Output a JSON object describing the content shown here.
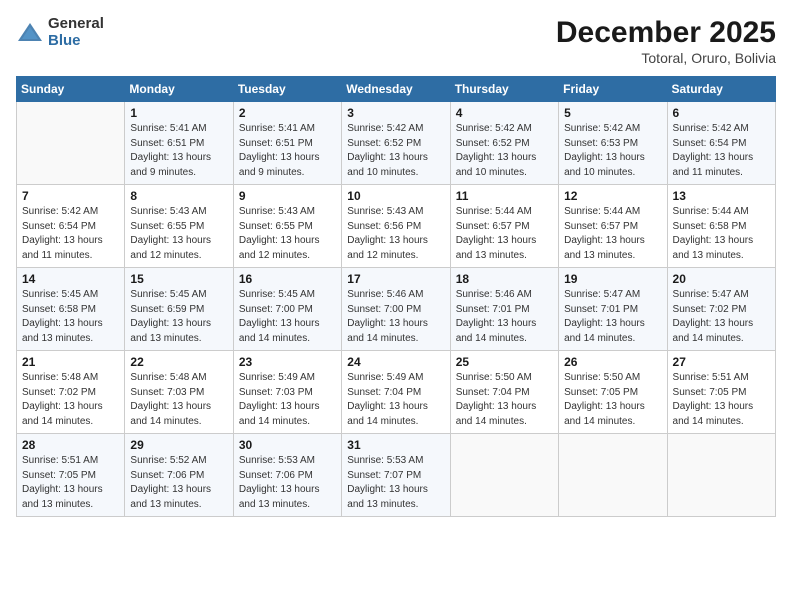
{
  "header": {
    "logo_line1": "General",
    "logo_line2": "Blue",
    "title": "December 2025",
    "subtitle": "Totoral, Oruro, Bolivia"
  },
  "calendar": {
    "columns": [
      "Sunday",
      "Monday",
      "Tuesday",
      "Wednesday",
      "Thursday",
      "Friday",
      "Saturday"
    ],
    "weeks": [
      [
        {
          "day": "",
          "info": ""
        },
        {
          "day": "1",
          "info": "Sunrise: 5:41 AM\nSunset: 6:51 PM\nDaylight: 13 hours\nand 9 minutes."
        },
        {
          "day": "2",
          "info": "Sunrise: 5:41 AM\nSunset: 6:51 PM\nDaylight: 13 hours\nand 9 minutes."
        },
        {
          "day": "3",
          "info": "Sunrise: 5:42 AM\nSunset: 6:52 PM\nDaylight: 13 hours\nand 10 minutes."
        },
        {
          "day": "4",
          "info": "Sunrise: 5:42 AM\nSunset: 6:52 PM\nDaylight: 13 hours\nand 10 minutes."
        },
        {
          "day": "5",
          "info": "Sunrise: 5:42 AM\nSunset: 6:53 PM\nDaylight: 13 hours\nand 10 minutes."
        },
        {
          "day": "6",
          "info": "Sunrise: 5:42 AM\nSunset: 6:54 PM\nDaylight: 13 hours\nand 11 minutes."
        }
      ],
      [
        {
          "day": "7",
          "info": "Sunrise: 5:42 AM\nSunset: 6:54 PM\nDaylight: 13 hours\nand 11 minutes."
        },
        {
          "day": "8",
          "info": "Sunrise: 5:43 AM\nSunset: 6:55 PM\nDaylight: 13 hours\nand 12 minutes."
        },
        {
          "day": "9",
          "info": "Sunrise: 5:43 AM\nSunset: 6:55 PM\nDaylight: 13 hours\nand 12 minutes."
        },
        {
          "day": "10",
          "info": "Sunrise: 5:43 AM\nSunset: 6:56 PM\nDaylight: 13 hours\nand 12 minutes."
        },
        {
          "day": "11",
          "info": "Sunrise: 5:44 AM\nSunset: 6:57 PM\nDaylight: 13 hours\nand 13 minutes."
        },
        {
          "day": "12",
          "info": "Sunrise: 5:44 AM\nSunset: 6:57 PM\nDaylight: 13 hours\nand 13 minutes."
        },
        {
          "day": "13",
          "info": "Sunrise: 5:44 AM\nSunset: 6:58 PM\nDaylight: 13 hours\nand 13 minutes."
        }
      ],
      [
        {
          "day": "14",
          "info": "Sunrise: 5:45 AM\nSunset: 6:58 PM\nDaylight: 13 hours\nand 13 minutes."
        },
        {
          "day": "15",
          "info": "Sunrise: 5:45 AM\nSunset: 6:59 PM\nDaylight: 13 hours\nand 13 minutes."
        },
        {
          "day": "16",
          "info": "Sunrise: 5:45 AM\nSunset: 7:00 PM\nDaylight: 13 hours\nand 14 minutes."
        },
        {
          "day": "17",
          "info": "Sunrise: 5:46 AM\nSunset: 7:00 PM\nDaylight: 13 hours\nand 14 minutes."
        },
        {
          "day": "18",
          "info": "Sunrise: 5:46 AM\nSunset: 7:01 PM\nDaylight: 13 hours\nand 14 minutes."
        },
        {
          "day": "19",
          "info": "Sunrise: 5:47 AM\nSunset: 7:01 PM\nDaylight: 13 hours\nand 14 minutes."
        },
        {
          "day": "20",
          "info": "Sunrise: 5:47 AM\nSunset: 7:02 PM\nDaylight: 13 hours\nand 14 minutes."
        }
      ],
      [
        {
          "day": "21",
          "info": "Sunrise: 5:48 AM\nSunset: 7:02 PM\nDaylight: 13 hours\nand 14 minutes."
        },
        {
          "day": "22",
          "info": "Sunrise: 5:48 AM\nSunset: 7:03 PM\nDaylight: 13 hours\nand 14 minutes."
        },
        {
          "day": "23",
          "info": "Sunrise: 5:49 AM\nSunset: 7:03 PM\nDaylight: 13 hours\nand 14 minutes."
        },
        {
          "day": "24",
          "info": "Sunrise: 5:49 AM\nSunset: 7:04 PM\nDaylight: 13 hours\nand 14 minutes."
        },
        {
          "day": "25",
          "info": "Sunrise: 5:50 AM\nSunset: 7:04 PM\nDaylight: 13 hours\nand 14 minutes."
        },
        {
          "day": "26",
          "info": "Sunrise: 5:50 AM\nSunset: 7:05 PM\nDaylight: 13 hours\nand 14 minutes."
        },
        {
          "day": "27",
          "info": "Sunrise: 5:51 AM\nSunset: 7:05 PM\nDaylight: 13 hours\nand 14 minutes."
        }
      ],
      [
        {
          "day": "28",
          "info": "Sunrise: 5:51 AM\nSunset: 7:05 PM\nDaylight: 13 hours\nand 13 minutes."
        },
        {
          "day": "29",
          "info": "Sunrise: 5:52 AM\nSunset: 7:06 PM\nDaylight: 13 hours\nand 13 minutes."
        },
        {
          "day": "30",
          "info": "Sunrise: 5:53 AM\nSunset: 7:06 PM\nDaylight: 13 hours\nand 13 minutes."
        },
        {
          "day": "31",
          "info": "Sunrise: 5:53 AM\nSunset: 7:07 PM\nDaylight: 13 hours\nand 13 minutes."
        },
        {
          "day": "",
          "info": ""
        },
        {
          "day": "",
          "info": ""
        },
        {
          "day": "",
          "info": ""
        }
      ]
    ]
  }
}
